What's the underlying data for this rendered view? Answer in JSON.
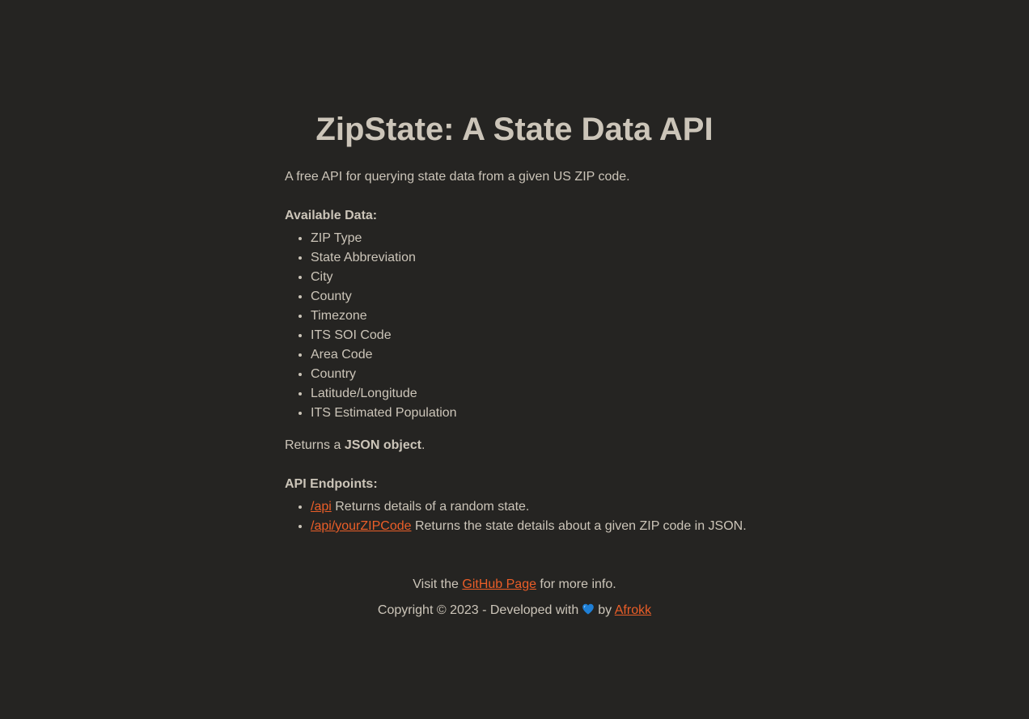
{
  "title": "ZipState: A State Data API",
  "description": "A free API for querying state data from a given US ZIP code.",
  "available_data": {
    "heading": "Available Data:",
    "items": [
      "ZIP Type",
      "State Abbreviation",
      "City",
      "County",
      "Timezone",
      "ITS SOI Code",
      "Area Code",
      "Country",
      "Latitude/Longitude",
      "ITS Estimated Population"
    ]
  },
  "returns": {
    "prefix": "Returns a ",
    "bold": "JSON object",
    "suffix": "."
  },
  "endpoints": {
    "heading": "API Endpoints:",
    "items": [
      {
        "path": "/api",
        "text": " Returns details of a random state."
      },
      {
        "path": "/api/yourZIPCode",
        "text": " Returns the state details about a given ZIP code in JSON."
      }
    ]
  },
  "footer": {
    "visit_prefix": "Visit the ",
    "github_link": "GitHub Page",
    "visit_suffix": " for more info.",
    "copyright_prefix": "Copyright © 2023 - Developed with",
    "by": "by",
    "author_link": "Afrokk",
    "heart_icon": "blue-heart-icon"
  },
  "colors": {
    "background": "#252422",
    "text": "#ccc5b9",
    "link": "#eb5e28",
    "heart": "#1e7fd6"
  }
}
